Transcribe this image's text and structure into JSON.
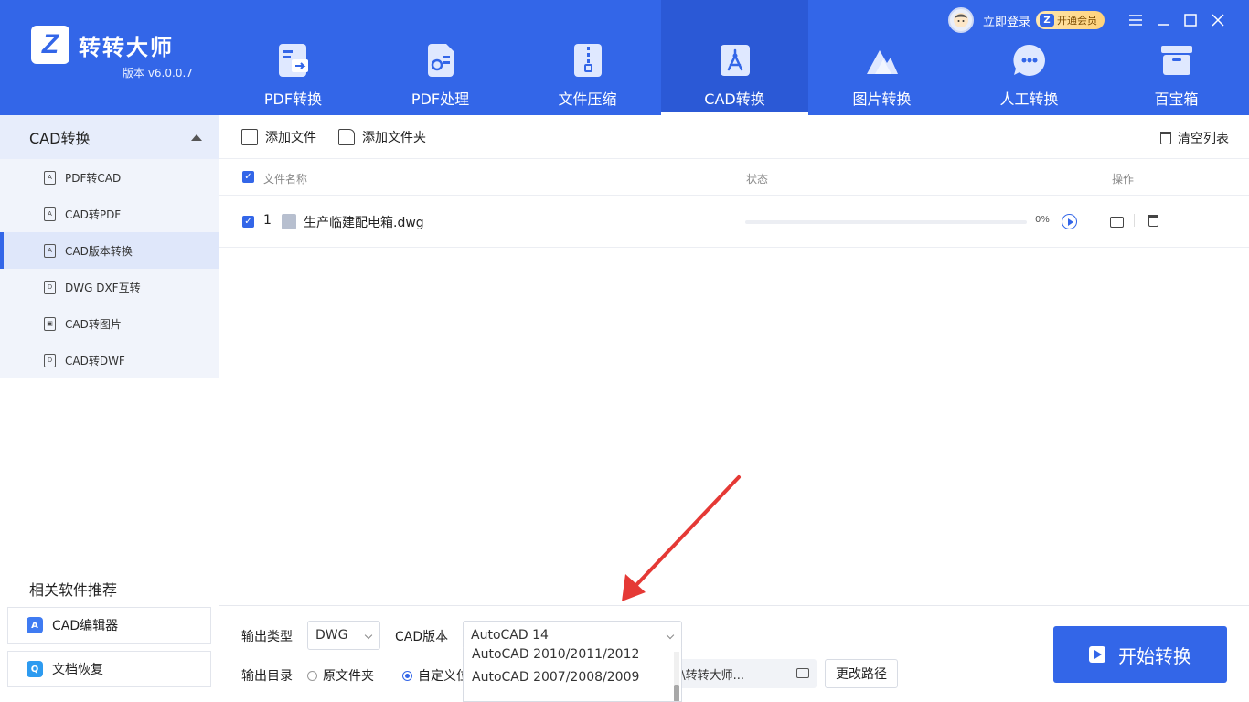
{
  "app": {
    "name": "转转大师",
    "version": "版本 v6.0.0.7",
    "logo_letter": "Z"
  },
  "header": {
    "login_label": "立即登录",
    "vip_label": "开通会员",
    "vip_badge_letter": "Z",
    "nav": [
      {
        "label": "PDF转换",
        "icon": "pdf-convert-icon"
      },
      {
        "label": "PDF处理",
        "icon": "pdf-process-icon"
      },
      {
        "label": "文件压缩",
        "icon": "zip-icon"
      },
      {
        "label": "CAD转换",
        "icon": "cad-icon",
        "active": true
      },
      {
        "label": "图片转换",
        "icon": "image-icon"
      },
      {
        "label": "人工转换",
        "icon": "chat-icon"
      },
      {
        "label": "百宝箱",
        "icon": "toolbox-icon"
      }
    ]
  },
  "sidebar": {
    "section_title": "CAD转换",
    "items": [
      {
        "label": "PDF转CAD",
        "glyph": "A"
      },
      {
        "label": "CAD转PDF",
        "glyph": "A"
      },
      {
        "label": "CAD版本转换",
        "glyph": "A",
        "active": true
      },
      {
        "label": "DWG DXF互转",
        "glyph": "D"
      },
      {
        "label": "CAD转图片",
        "glyph": "▣"
      },
      {
        "label": "CAD转DWF",
        "glyph": "D"
      }
    ],
    "recommend_title": "相关软件推荐",
    "recommend": [
      {
        "label": "CAD编辑器",
        "icon_text": "A"
      },
      {
        "label": "文档恢复",
        "icon_text": "Q"
      }
    ]
  },
  "toolbar": {
    "add_file": "添加文件",
    "add_folder": "添加文件夹",
    "clear_list": "清空列表"
  },
  "table": {
    "columns": {
      "name": "文件名称",
      "status": "状态",
      "action": "操作"
    },
    "rows": [
      {
        "index": "1",
        "filename": "生产临建配电箱.dwg",
        "progress_text": "0%",
        "progress": 0
      }
    ]
  },
  "options": {
    "output_type_label": "输出类型",
    "output_type_value": "DWG",
    "cad_version_label": "CAD版本",
    "cad_version_value": "AutoCAD 14",
    "version_options": [
      "AutoCAD 2010/2011/2012",
      "AutoCAD 2007/2008/2009"
    ],
    "output_dir_label": "输出目录",
    "radio_original": "原文件夹",
    "radio_custom": "自定义位",
    "path_value": "p\\转转大师...",
    "change_path": "更改路径",
    "start_button": "开始转换"
  },
  "colors": {
    "brand": "#3366e8",
    "annotation_arrow": "#e53935"
  }
}
